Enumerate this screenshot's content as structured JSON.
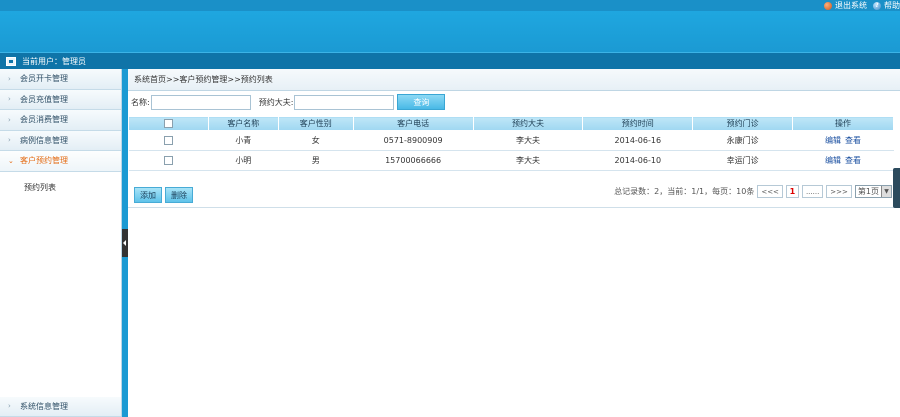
{
  "header": {
    "links": [
      {
        "label": "退出系统",
        "icon": "exit-icon"
      },
      {
        "label": "帮助",
        "icon": "help-icon"
      }
    ]
  },
  "userbar": {
    "text": "当前用户：管理员"
  },
  "sidebar": {
    "items": [
      {
        "label": "会员开卡管理"
      },
      {
        "label": "会员充值管理"
      },
      {
        "label": "会员消费管理"
      },
      {
        "label": "病例信息管理"
      },
      {
        "label": "客户预约管理"
      }
    ],
    "active_sub": "预约列表",
    "bottom_item": "系统信息管理"
  },
  "breadcrumb": "系统首页>>客户预约管理>>预约列表",
  "filters": {
    "name_label": "名称:",
    "doctor_label": "预约大夫:",
    "name_value": "",
    "doctor_value": "",
    "query_button": "查询"
  },
  "table": {
    "headers": [
      "客户名称",
      "客户性别",
      "客户电话",
      "预约大夫",
      "预约时间",
      "预约门诊",
      "操作"
    ],
    "rows": [
      {
        "name": "小青",
        "gender": "女",
        "phone": "0571-8900909",
        "doctor": "李大夫",
        "time": "2014-06-16",
        "clinic": "永康门诊",
        "edit": "编辑",
        "view": "查看"
      },
      {
        "name": "小明",
        "gender": "男",
        "phone": "15700066666",
        "doctor": "李大夫",
        "time": "2014-06-10",
        "clinic": "幸运门诊",
        "edit": "编辑",
        "view": "查看"
      }
    ]
  },
  "actions": {
    "add": "添加",
    "delete": "删除"
  },
  "pager": {
    "summary": "总记录数：2，当前：1/1，每页：10条",
    "prev": "<<<",
    "current": "1",
    "ellipsis": "......",
    "next": ">>>",
    "page_select": "第1页"
  }
}
